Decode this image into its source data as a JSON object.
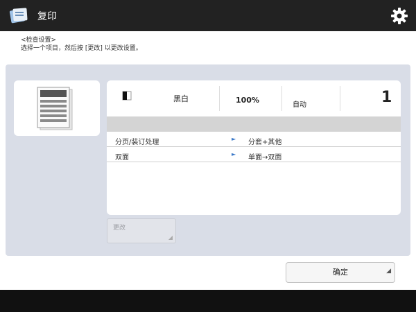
{
  "header": {
    "title": "复印",
    "settings_icon": "gear-icon",
    "app_icon": "copy-app-icon"
  },
  "instructions": {
    "line1": "<检查设置>",
    "line2": "选择一个项目，然后按 [更改] 以更改设置。"
  },
  "status": {
    "color_icon": "color-mode-icon",
    "color_mode": "黑白",
    "zoom": "100%",
    "paper": "自动",
    "copies": "1"
  },
  "settings": [
    {
      "label": "分页/装订处理",
      "value": "分套+其他"
    },
    {
      "label": "双面",
      "value": "单面→双面"
    }
  ],
  "buttons": {
    "change": "更改",
    "ok": "确定"
  },
  "colors": {
    "titlebar": "#222222",
    "panel": "#d9dde7",
    "accent": "#3a78c8"
  }
}
